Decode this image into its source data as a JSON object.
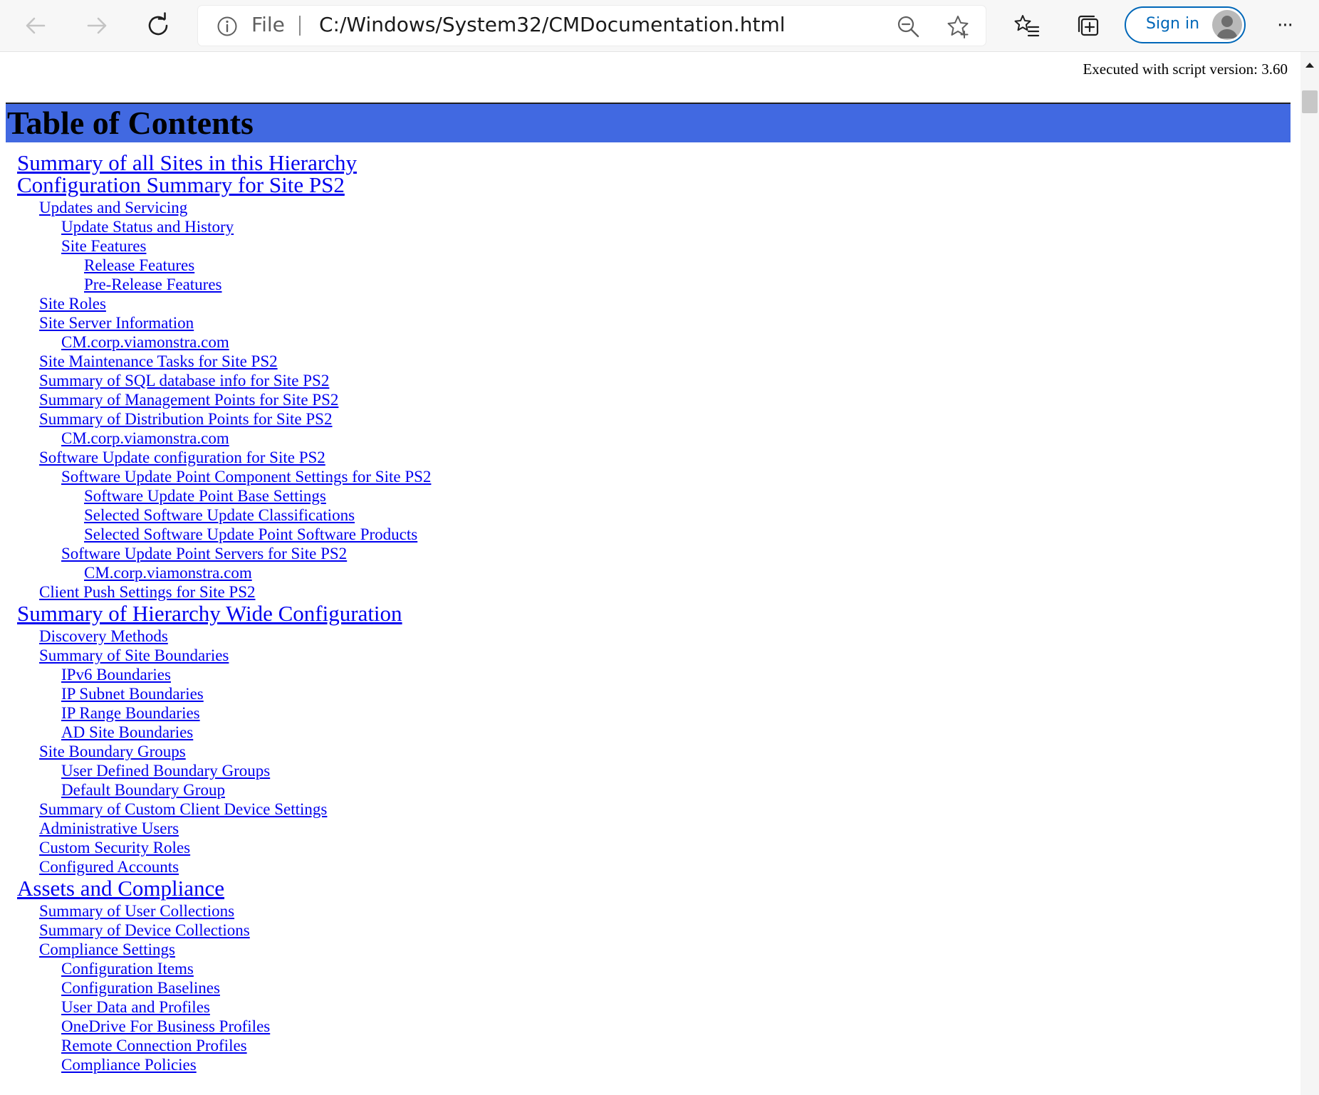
{
  "browser": {
    "file_label": "File",
    "url": "C:/Windows/System32/CMDocumentation.html",
    "signin_label": "Sign in",
    "more_label": "···",
    "icons": {
      "back": "back-arrow-icon",
      "forward": "forward-arrow-icon",
      "refresh": "refresh-icon",
      "info": "info-icon",
      "zoom": "zoom-out-icon",
      "favorite": "add-favorite-star-icon",
      "favorites": "favorites-list-icon",
      "collections": "collections-icon",
      "avatar": "user-avatar-icon"
    },
    "colors": {
      "signin": "#0067b8",
      "toc_header": "#4169e1",
      "link": "#0000ee"
    }
  },
  "page": {
    "exec_line": "Executed with script version: 3.60",
    "toc_title": "Table of Contents",
    "toc": [
      {
        "level": 1,
        "text": "Summary of all Sites in this Hierarchy"
      },
      {
        "level": 1,
        "text": "Configuration Summary for Site PS2"
      },
      {
        "level": 2,
        "text": "Updates and Servicing"
      },
      {
        "level": 3,
        "text": "Update Status and History"
      },
      {
        "level": 3,
        "text": "Site Features"
      },
      {
        "level": 4,
        "text": "Release Features"
      },
      {
        "level": 4,
        "text": "Pre-Release Features"
      },
      {
        "level": 2,
        "text": "Site Roles"
      },
      {
        "level": 2,
        "text": "Site Server Information"
      },
      {
        "level": 3,
        "text": "CM.corp.viamonstra.com"
      },
      {
        "level": 2,
        "text": "Site Maintenance Tasks for Site PS2"
      },
      {
        "level": 2,
        "text": "Summary of SQL database info for Site PS2"
      },
      {
        "level": 2,
        "text": "Summary of Management Points for Site PS2"
      },
      {
        "level": 2,
        "text": "Summary of Distribution Points for Site PS2"
      },
      {
        "level": 3,
        "text": "CM.corp.viamonstra.com"
      },
      {
        "level": 2,
        "text": "Software Update configuration for Site PS2"
      },
      {
        "level": 3,
        "text": "Software Update Point Component Settings for Site PS2"
      },
      {
        "level": 4,
        "text": "Software Update Point Base Settings"
      },
      {
        "level": 4,
        "text": "Selected Software Update Classifications"
      },
      {
        "level": 4,
        "text": "Selected Software Update Point Software Products"
      },
      {
        "level": 3,
        "text": "Software Update Point Servers for Site PS2"
      },
      {
        "level": 4,
        "text": "CM.corp.viamonstra.com"
      },
      {
        "level": 2,
        "text": "Client Push Settings for Site PS2"
      },
      {
        "level": 1,
        "text": "Summary of Hierarchy Wide Configuration"
      },
      {
        "level": 2,
        "text": "Discovery Methods"
      },
      {
        "level": 2,
        "text": "Summary of Site Boundaries"
      },
      {
        "level": 3,
        "text": "IPv6 Boundaries"
      },
      {
        "level": 3,
        "text": "IP Subnet Boundaries"
      },
      {
        "level": 3,
        "text": "IP Range Boundaries"
      },
      {
        "level": 3,
        "text": "AD Site Boundaries"
      },
      {
        "level": 2,
        "text": "Site Boundary Groups"
      },
      {
        "level": 3,
        "text": "User Defined Boundary Groups"
      },
      {
        "level": 3,
        "text": "Default Boundary Group"
      },
      {
        "level": 2,
        "text": "Summary of Custom Client Device Settings"
      },
      {
        "level": 2,
        "text": "Administrative Users"
      },
      {
        "level": 2,
        "text": "Custom Security Roles"
      },
      {
        "level": 2,
        "text": "Configured Accounts"
      },
      {
        "level": 1,
        "text": "Assets and Compliance"
      },
      {
        "level": 2,
        "text": "Summary of User Collections"
      },
      {
        "level": 2,
        "text": "Summary of Device Collections"
      },
      {
        "level": 2,
        "text": "Compliance Settings"
      },
      {
        "level": 3,
        "text": "Configuration Items"
      },
      {
        "level": 3,
        "text": "Configuration Baselines"
      },
      {
        "level": 3,
        "text": "User Data and Profiles"
      },
      {
        "level": 3,
        "text": "OneDrive For Business Profiles"
      },
      {
        "level": 3,
        "text": "Remote Connection Profiles"
      },
      {
        "level": 3,
        "text": "Compliance Policies"
      }
    ]
  }
}
